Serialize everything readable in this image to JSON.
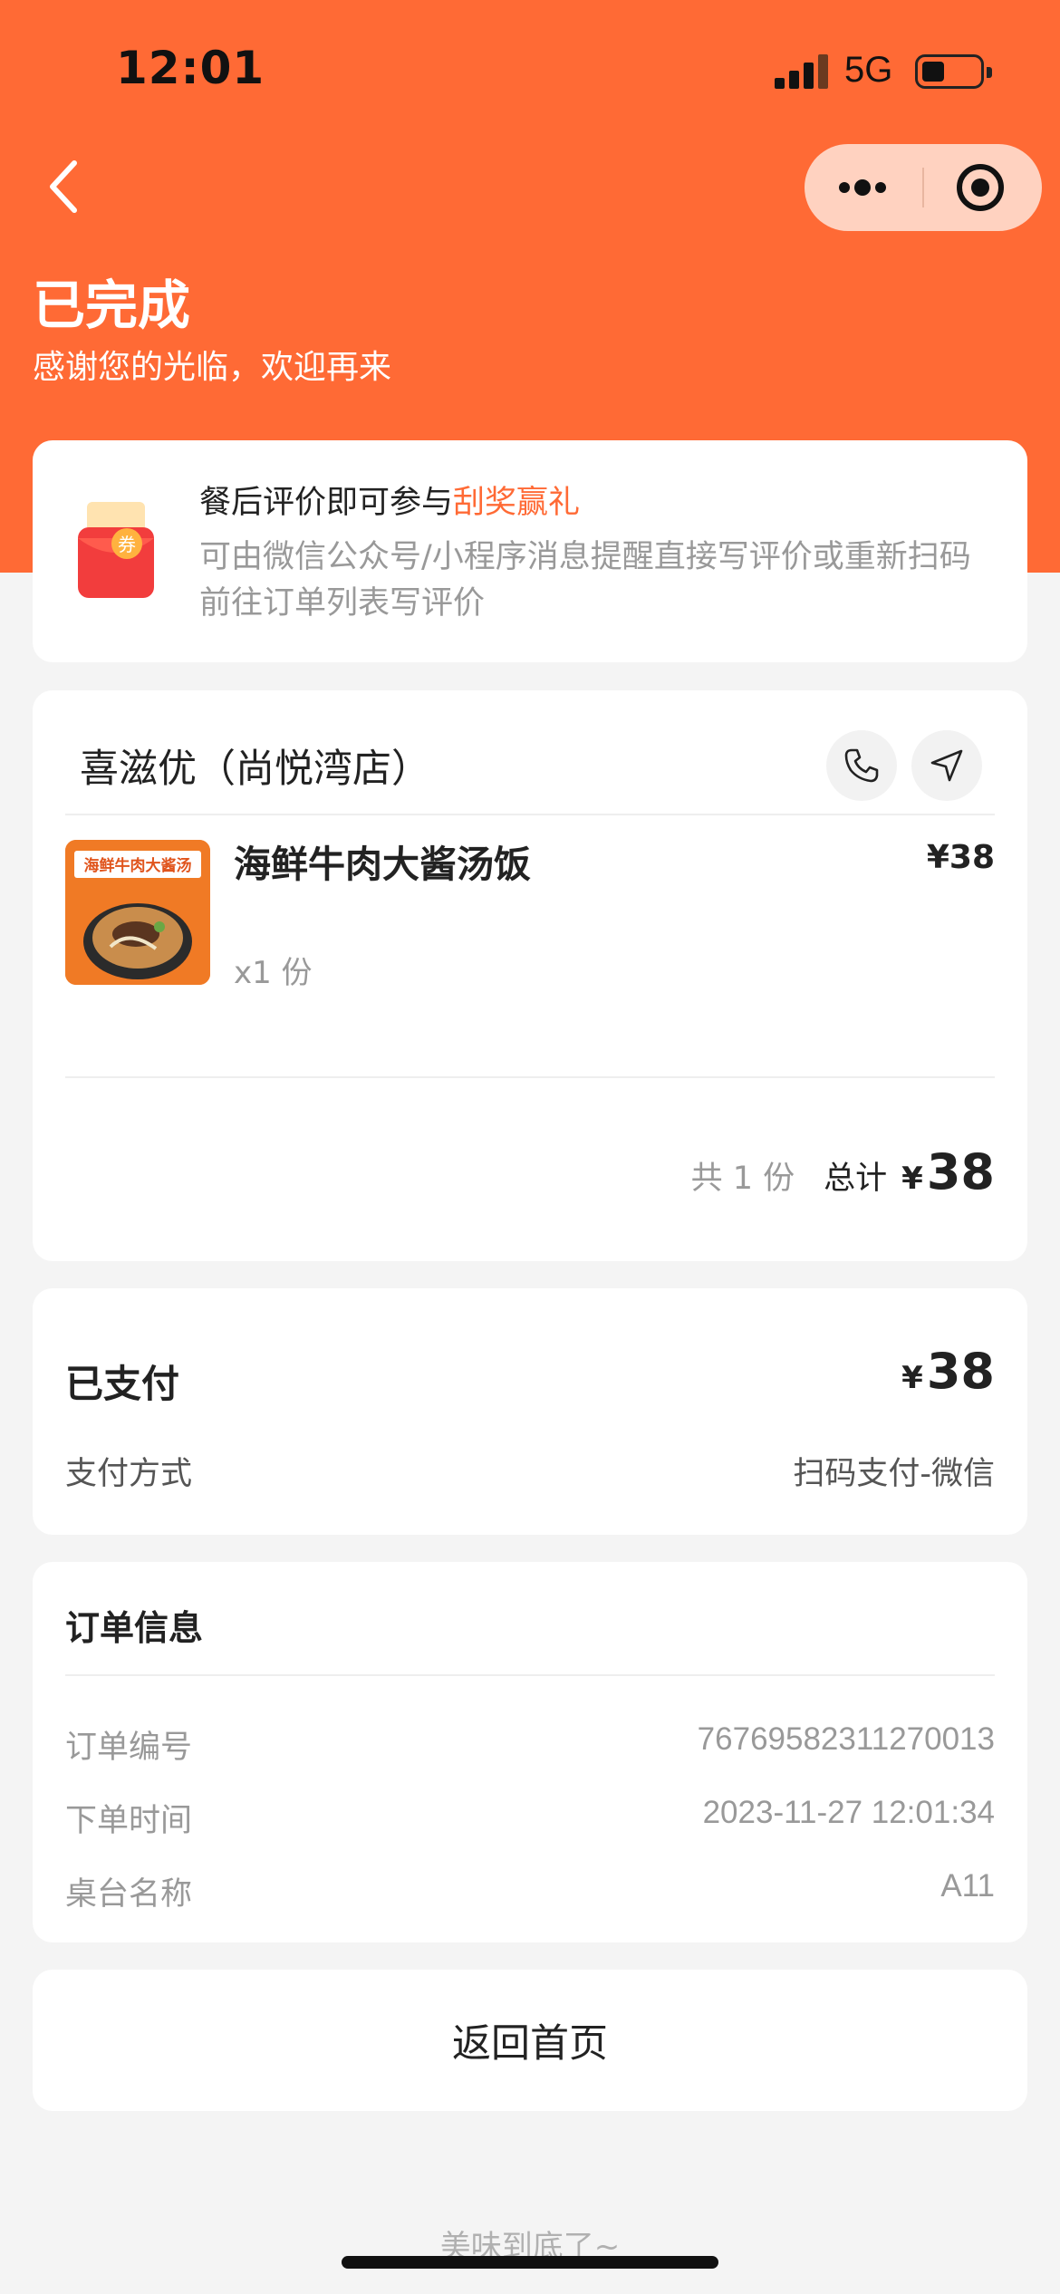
{
  "status_bar": {
    "time": "12:01",
    "network": "5G"
  },
  "header": {
    "title": "已完成",
    "subtitle": "感谢您的光临，欢迎再来"
  },
  "promo": {
    "icon_text": "券",
    "title_prefix": "餐后评价即可参与",
    "title_highlight": "刮奖赢礼",
    "description": "可由微信公众号/小程序消息提醒直接写评价或重新扫码前往订单列表写评价"
  },
  "order": {
    "shop_name": "喜滋优（尚悦湾店）",
    "items": [
      {
        "name": "海鲜牛肉大酱汤饭",
        "price": "¥38",
        "quantity": "x1 份",
        "image_caption": "海鲜牛肉大酱汤"
      }
    ],
    "total_count": "共 1 份",
    "total_label": "总计",
    "currency": "¥",
    "total_amount": "38"
  },
  "payment": {
    "status": "已支付",
    "currency": "¥",
    "amount": "38",
    "method_label": "支付方式",
    "method_value": "扫码支付-微信"
  },
  "order_info": {
    "title": "订单信息",
    "rows": [
      {
        "label": "订单编号",
        "value": "76769582311270013"
      },
      {
        "label": "下单时间",
        "value": "2023-11-27 12:01:34"
      },
      {
        "label": "桌台名称",
        "value": "A11"
      }
    ]
  },
  "actions": {
    "home_button": "返回首页"
  },
  "footer": {
    "text": "美味到底了~"
  },
  "colors": {
    "brand": "#ff6a35",
    "capsule": "#ffd2c0"
  }
}
